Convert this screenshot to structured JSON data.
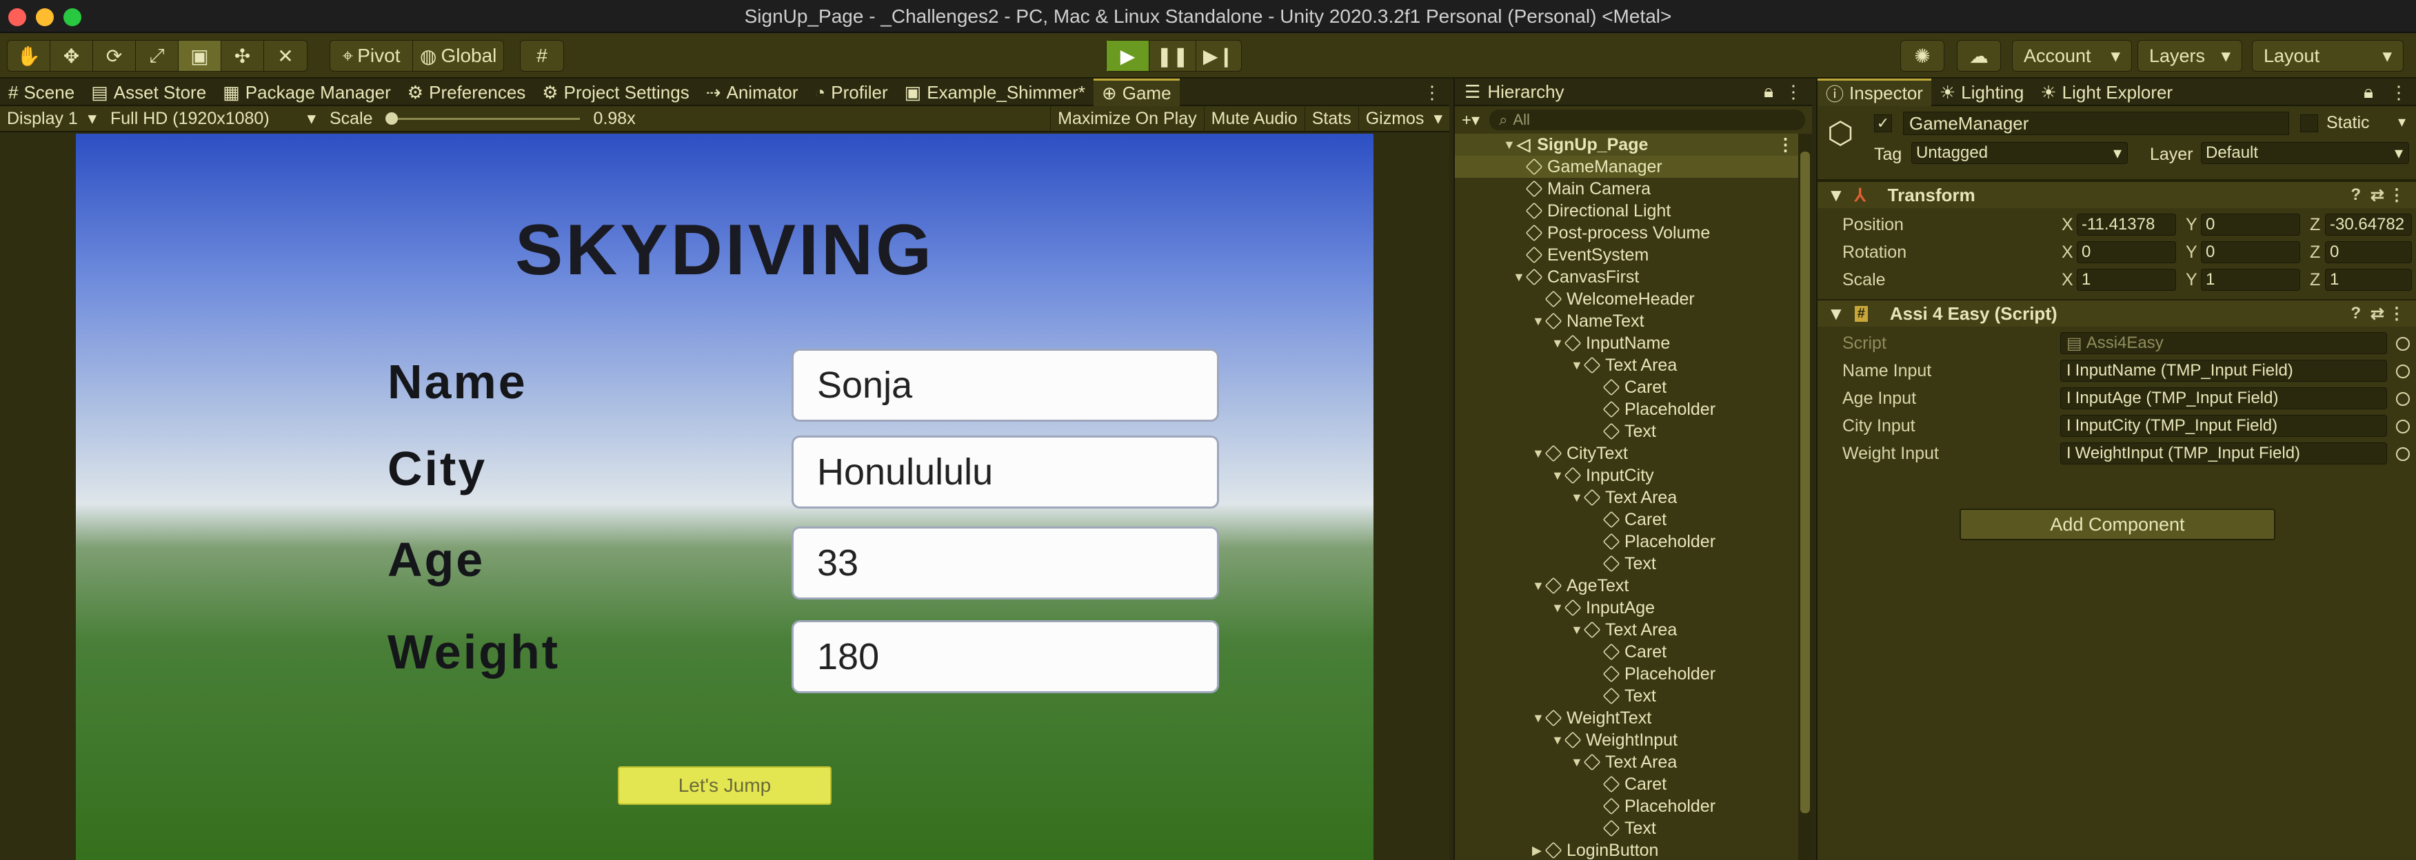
{
  "window": {
    "title": "SignUp_Page - _Challenges2 - PC, Mac & Linux Standalone - Unity 2020.3.2f1 Personal (Personal) <Metal>"
  },
  "toolbar": {
    "tools": [
      "hand-tool-icon",
      "move-tool-icon",
      "rotate-tool-icon",
      "scale-tool-icon",
      "rect-tool-icon",
      "transform-tool-icon",
      "custom-tool-icon"
    ],
    "pivot_label": "Pivot",
    "global_label": "Global",
    "account_label": "Account",
    "layers_label": "Layers",
    "layout_label": "Layout"
  },
  "tabs": {
    "scene": "Scene",
    "asset_store": "Asset Store",
    "package_manager": "Package Manager",
    "preferences": "Preferences",
    "project_settings": "Project Settings",
    "animator": "Animator",
    "profiler": "Profiler",
    "example_shimmer": "Example_Shimmer*",
    "game": "Game"
  },
  "gamebar": {
    "display": "Display 1",
    "resolution": "Full HD (1920x1080)",
    "scale_label": "Scale",
    "scale_value": "0.98x",
    "maximize": "Maximize On Play",
    "mute": "Mute Audio",
    "stats": "Stats",
    "gizmos": "Gizmos"
  },
  "game": {
    "title": "SKYDIVING",
    "name_label": "Name",
    "name_value": "Sonja",
    "city_label": "City",
    "city_value": "Honulululu",
    "age_label": "Age",
    "age_value": "33",
    "weight_label": "Weight",
    "weight_value": "180",
    "jump_label": "Let's Jump"
  },
  "hierarchy": {
    "title": "Hierarchy",
    "search_placeholder": "All",
    "scene_name": "SignUp_Page",
    "items": [
      {
        "label": "GameManager",
        "depth": 1,
        "selected": true,
        "arrow": ""
      },
      {
        "label": "Main Camera",
        "depth": 1,
        "arrow": ""
      },
      {
        "label": "Directional Light",
        "depth": 1,
        "arrow": ""
      },
      {
        "label": "Post-process Volume",
        "depth": 1,
        "arrow": ""
      },
      {
        "label": "EventSystem",
        "depth": 1,
        "arrow": ""
      },
      {
        "label": "CanvasFirst",
        "depth": 1,
        "arrow": "▼"
      },
      {
        "label": "WelcomeHeader",
        "depth": 2,
        "arrow": ""
      },
      {
        "label": "NameText",
        "depth": 2,
        "arrow": "▼"
      },
      {
        "label": "InputName",
        "depth": 3,
        "arrow": "▼"
      },
      {
        "label": "Text Area",
        "depth": 4,
        "arrow": "▼"
      },
      {
        "label": "Caret",
        "depth": 5,
        "arrow": ""
      },
      {
        "label": "Placeholder",
        "depth": 5,
        "arrow": ""
      },
      {
        "label": "Text",
        "depth": 5,
        "arrow": ""
      },
      {
        "label": "CityText",
        "depth": 2,
        "arrow": "▼"
      },
      {
        "label": "InputCity",
        "depth": 3,
        "arrow": "▼"
      },
      {
        "label": "Text Area",
        "depth": 4,
        "arrow": "▼"
      },
      {
        "label": "Caret",
        "depth": 5,
        "arrow": ""
      },
      {
        "label": "Placeholder",
        "depth": 5,
        "arrow": ""
      },
      {
        "label": "Text",
        "depth": 5,
        "arrow": ""
      },
      {
        "label": "AgeText",
        "depth": 2,
        "arrow": "▼"
      },
      {
        "label": "InputAge",
        "depth": 3,
        "arrow": "▼"
      },
      {
        "label": "Text Area",
        "depth": 4,
        "arrow": "▼"
      },
      {
        "label": "Caret",
        "depth": 5,
        "arrow": ""
      },
      {
        "label": "Placeholder",
        "depth": 5,
        "arrow": ""
      },
      {
        "label": "Text",
        "depth": 5,
        "arrow": ""
      },
      {
        "label": "WeightText",
        "depth": 2,
        "arrow": "▼"
      },
      {
        "label": "WeightInput",
        "depth": 3,
        "arrow": "▼"
      },
      {
        "label": "Text Area",
        "depth": 4,
        "arrow": "▼"
      },
      {
        "label": "Caret",
        "depth": 5,
        "arrow": ""
      },
      {
        "label": "Placeholder",
        "depth": 5,
        "arrow": ""
      },
      {
        "label": "Text",
        "depth": 5,
        "arrow": ""
      },
      {
        "label": "LoginButton",
        "depth": 2,
        "arrow": "▶"
      }
    ]
  },
  "inspector": {
    "tab_inspector": "Inspector",
    "tab_lighting": "Lighting",
    "tab_light_explorer": "Light Explorer",
    "object_name": "GameManager",
    "static_label": "Static",
    "tag_label": "Tag",
    "tag_value": "Untagged",
    "layer_label": "Layer",
    "layer_value": "Default",
    "transform": {
      "title": "Transform",
      "position_label": "Position",
      "rotation_label": "Rotation",
      "scale_label": "Scale",
      "position": {
        "x": "-11.41378",
        "y": "0",
        "z": "-30.64782"
      },
      "rotation": {
        "x": "0",
        "y": "0",
        "z": "0"
      },
      "scale": {
        "x": "1",
        "y": "1",
        "z": "1"
      }
    },
    "script": {
      "title": "Assi 4 Easy (Script)",
      "script_label": "Script",
      "script_value": "Assi4Easy",
      "name_input_label": "Name Input",
      "name_input_value": "InputName (TMP_Input Field)",
      "age_input_label": "Age Input",
      "age_input_value": "InputAge (TMP_Input Field)",
      "city_input_label": "City Input",
      "city_input_value": "InputCity (TMP_Input Field)",
      "weight_input_label": "Weight Input",
      "weight_input_value": "WeightInput (TMP_Input Field)"
    },
    "add_component": "Add Component"
  },
  "labels": {
    "x": "X",
    "y": "Y",
    "z": "Z"
  }
}
